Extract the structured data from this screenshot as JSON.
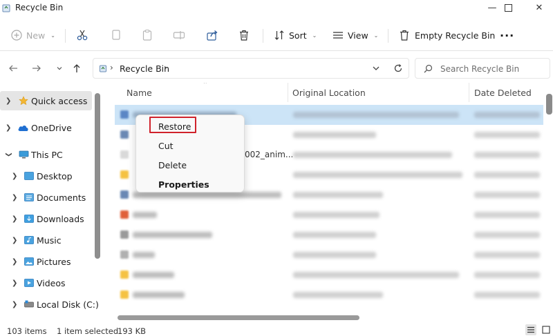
{
  "window": {
    "title": "Recycle Bin",
    "minimize_glyph": "—",
    "maximize_glyph": "☐",
    "close_glyph": "✕"
  },
  "toolbar": {
    "new_label": "New",
    "sort_label": "Sort",
    "view_label": "View",
    "empty_label": "Empty Recycle Bin",
    "more_glyph": "···",
    "caret": "⌄"
  },
  "address": {
    "chevron": "›",
    "path": "Recycle Bin",
    "search_placeholder": "Search Recycle Bin"
  },
  "sidebar": {
    "items": [
      {
        "label": "Quick access",
        "icon": "star-icon",
        "selected": true
      },
      {
        "label": "OneDrive",
        "icon": "cloud-icon"
      },
      {
        "label": "This PC",
        "icon": "computer-icon"
      },
      {
        "label": "Desktop",
        "icon": "desktop-folder-icon"
      },
      {
        "label": "Documents",
        "icon": "documents-folder-icon"
      },
      {
        "label": "Downloads",
        "icon": "downloads-folder-icon"
      },
      {
        "label": "Music",
        "icon": "music-folder-icon"
      },
      {
        "label": "Pictures",
        "icon": "pictures-folder-icon"
      },
      {
        "label": "Videos",
        "icon": "videos-folder-icon"
      },
      {
        "label": "Local Disk (C:)",
        "icon": "drive-icon"
      }
    ]
  },
  "columns": {
    "name": "Name",
    "original_location": "Original Location",
    "date_deleted": "Date Deleted"
  },
  "rows": {
    "partial_name_text": "002_anim..."
  },
  "context_menu": {
    "restore": "Restore",
    "cut": "Cut",
    "delete": "Delete",
    "properties": "Properties"
  },
  "status": {
    "item_count": "103 items",
    "selection": "1 item selected",
    "size": "193 KB"
  },
  "colors": {
    "selection": "#cce4f7",
    "highlight_box": "#d0222b",
    "folder": "#f5c242",
    "accent": "#0078d4"
  }
}
